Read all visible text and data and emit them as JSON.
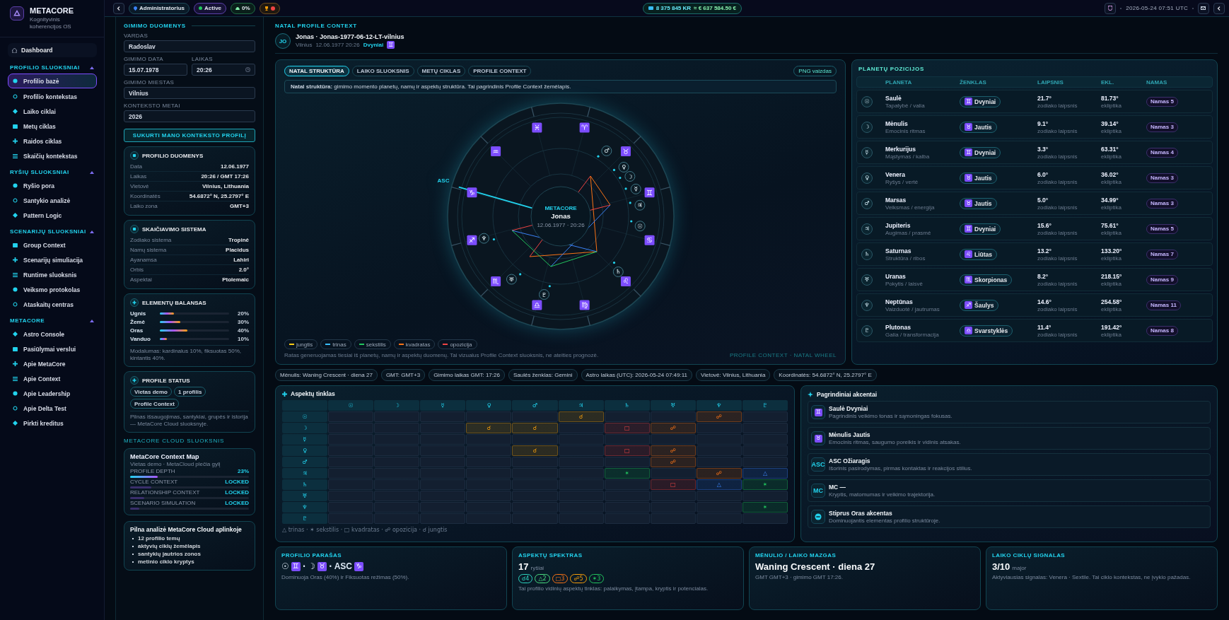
{
  "sidebar": {
    "brand": "METACORE",
    "tagline": "Kognityvinis koherencijos OS",
    "dashboard": "Dashboard",
    "sections": [
      {
        "title": "PROFILIO SLUOKSNIAI",
        "expanded": true,
        "items": [
          {
            "label": "Profilio bazė",
            "selected": true
          },
          {
            "label": "Profilio kontekstas",
            "selected": false
          },
          {
            "label": "Laiko ciklai",
            "selected": false
          },
          {
            "label": "Metų ciklas",
            "selected": false
          },
          {
            "label": "Raidos ciklas",
            "selected": false
          },
          {
            "label": "Skaičių kontekstas",
            "selected": false
          }
        ]
      },
      {
        "title": "RYŠIŲ SLUOKSNIAI",
        "expanded": true,
        "items": [
          {
            "label": "Ryšio pora",
            "selected": false
          },
          {
            "label": "Santykio analizė",
            "selected": false
          },
          {
            "label": "Pattern Logic",
            "selected": false
          }
        ]
      },
      {
        "title": "SCENARIJŲ SLUOKSNIAI",
        "expanded": true,
        "items": [
          {
            "label": "Group Context",
            "selected": false
          },
          {
            "label": "Scenarijų simuliacija",
            "selected": false
          },
          {
            "label": "Runtime sluoksnis",
            "selected": false
          },
          {
            "label": "Veiksmo protokolas",
            "selected": false
          },
          {
            "label": "Ataskaitų centras",
            "selected": false
          }
        ]
      },
      {
        "title": "METACORE",
        "expanded": true,
        "items": [
          {
            "label": "Astro Console",
            "selected": false
          },
          {
            "label": "Pasiūlymai verslui",
            "selected": false
          },
          {
            "label": "Apie MetaCore",
            "selected": false
          },
          {
            "label": "Apie Context",
            "selected": false
          },
          {
            "label": "Apie Leadership",
            "selected": false
          },
          {
            "label": "Apie Delta Test",
            "selected": false
          },
          {
            "label": "Pirkti kreditus",
            "selected": false
          }
        ]
      }
    ]
  },
  "topbar": {
    "role": "Administratorius",
    "status": "Active",
    "cloud": "0%",
    "balance_kr": "8 375 845 KR",
    "balance_eur": "≈ € 637 584.50 €",
    "datetime": "2026-05-24 07:51 UTC"
  },
  "birth_form": {
    "title": "GIMIMO DUOMENYS",
    "rows": [
      [
        {
          "kind": "text",
          "label": "VARDAS",
          "value": "Radoslav"
        }
      ],
      [
        {
          "kind": "text",
          "label": "GIMIMO DATA",
          "value": "15.07.1978"
        },
        {
          "kind": "time",
          "label": "LAIKAS",
          "value": "20:26"
        }
      ],
      [
        {
          "kind": "text",
          "label": "GIMIMO MIESTAS",
          "value": "Vilnius"
        }
      ],
      [
        {
          "kind": "text",
          "label": "KONTEKSTO METAI",
          "value": "2026"
        }
      ]
    ],
    "submit": "SUKURTI MANO KONTEKSTO PROFILĮ"
  },
  "profile_data": {
    "title": "PROFILIO DUOMENYS",
    "rows": [
      {
        "label": "Data",
        "value": "12.06.1977"
      },
      {
        "label": "Laikas",
        "value": "20:26 / GMT 17:26"
      },
      {
        "label": "Vietovė",
        "value": "Vilnius, Lithuania"
      },
      {
        "label": "Koordinatės",
        "value": "54.6872° N, 25.2797° E"
      },
      {
        "label": "Laiko zona",
        "value": "GMT+3"
      }
    ]
  },
  "calc_system": {
    "title": "SKAIČIAVIMO SISTEMA",
    "rows": [
      {
        "label": "Zodiako sistema",
        "value": "Tropinė"
      },
      {
        "label": "Namų sistema",
        "value": "Placidus"
      },
      {
        "label": "Ayanamsa",
        "value": "Lahiri"
      },
      {
        "label": "Orbis",
        "value": "2.0°"
      },
      {
        "label": "Aspektai",
        "value": "Ptolemaic"
      }
    ]
  },
  "elements": {
    "title": "ELEMENTŲ BALANSAS",
    "items": [
      {
        "name": "Ugnis",
        "level": 0.2,
        "reading": "20%"
      },
      {
        "name": "Žemė",
        "level": 0.3,
        "reading": "30%"
      },
      {
        "name": "Oras",
        "level": 0.4,
        "reading": "40%"
      },
      {
        "name": "Vanduo",
        "level": 0.1,
        "reading": "10%"
      }
    ],
    "note": "Modalumas: kardinalus 10%, fiksuotas 50%, kintantis 40%."
  },
  "profile_status": {
    "title": "PROFILE STATUS",
    "chips": [
      "Vietas demo",
      "1 profilis",
      "Profile Context"
    ],
    "note": "Pilnas išsaugojimas, santykiai, grupės ir istorija — MetaCore Cloud sluoksnyje."
  },
  "cloud_label": "METACORE CLOUD SLUOKSNIS",
  "context_map": {
    "title": "MetaCore Context Map",
    "subtitle": "Vietas demo · MetaCloud plečia gylį",
    "items": [
      {
        "label": "PROFILE DEPTH",
        "value": "23%",
        "locked": false,
        "level": 0.23
      },
      {
        "label": "CYCLE CONTEXT",
        "value": "LOCKED",
        "locked": true,
        "level": 0.18
      },
      {
        "label": "RELATIONSHIP CONTEXT",
        "value": "LOCKED",
        "locked": true,
        "level": 0.12
      },
      {
        "label": "SCENARIO SIMULATION",
        "value": "LOCKED",
        "locked": true,
        "level": 0.08
      }
    ]
  },
  "full_analysis": {
    "title": "Pilna analizė MetaCore Cloud aplinkoje",
    "items": [
      "12 profilio temų",
      "aktyvių ciklų žemėlapis",
      "santykių jautrios zonos",
      "metinio ciklo kryptys"
    ]
  },
  "header": {
    "section": "NATAL PROFILE CONTEXT",
    "initials": "JO",
    "title": "Jonas · Jonas-1977-06-12-LT-vilnius",
    "city": "Vilnius",
    "datetime": "12.06.1977 20:26",
    "sign": "Dvyniai",
    "sign_glyph": "♊"
  },
  "wheel_card": {
    "tabs": [
      {
        "label": "NATAL STRUKTŪRA",
        "selected": true
      },
      {
        "label": "LAIKO SLUOKSNIS",
        "selected": false
      },
      {
        "label": "METŲ CIKLAS",
        "selected": false
      },
      {
        "label": "PROFILE CONTEXT",
        "selected": false
      }
    ],
    "png_button": "PNG vaizdas",
    "note": "**Natal struktūra:** gimimo momento planetų, namų ir aspektų struktūra. Tai pagrindinis Profile Context žemėlapis.",
    "wheel": {
      "signs": [
        "♈",
        "♉",
        "♊",
        "♋",
        "♌",
        "♍",
        "♎",
        "♏",
        "♐",
        "♑",
        "♒",
        "♓"
      ],
      "planets": [
        "♂",
        "♀",
        "☽",
        "☿",
        "♃",
        "☉",
        "♄",
        "♇",
        "♅",
        "♆"
      ],
      "asc": "ASC",
      "center_brand": "METACORE",
      "center_name": "Jonas",
      "center_date": "12.06.1977 · 20:26"
    },
    "legend": [
      {
        "label": "jungtis",
        "color": "#facc15"
      },
      {
        "label": "trinas",
        "color": "#38bdf8"
      },
      {
        "label": "sekstilis",
        "color": "#22c55e"
      },
      {
        "label": "kvadratas",
        "color": "#f97316"
      },
      {
        "label": "opozicija",
        "color": "#ef4444"
      }
    ],
    "footer": "Ratas generuojamas tiesiai iš planetų, namų ir aspektų duomenų. Tai vizualus Profile Context sluoksnis, ne ateities prognozė.",
    "footer_tag": "PROFILE CONTEXT · NATAL WHEEL"
  },
  "planet_table": {
    "title": "PLANETŲ POZICIJOS",
    "columns": [
      "PLANETA",
      "ŽENKLAS",
      "LAIPSNIS",
      "EKL.",
      "NAMAS"
    ],
    "rows": [
      {
        "glyph": "☉",
        "name": "Saulė",
        "meaning": "Tapatybė / valia",
        "sign_glyph": "♊",
        "sign": "Dvyniai",
        "degree": "21.7°",
        "degree_note": "zodiako laipsnis",
        "ecliptic": "81.73°",
        "ecliptic_note": "ekliptika",
        "house": "Namas 5"
      },
      {
        "glyph": "☽",
        "name": "Mėnulis",
        "meaning": "Emocinis ritmas",
        "sign_glyph": "♉",
        "sign": "Jautis",
        "degree": "9.1°",
        "degree_note": "zodiako laipsnis",
        "ecliptic": "39.14°",
        "ecliptic_note": "ekliptika",
        "house": "Namas 3"
      },
      {
        "glyph": "☿",
        "name": "Merkurijus",
        "meaning": "Mąstymas / kalba",
        "sign_glyph": "♊",
        "sign": "Dvyniai",
        "degree": "3.3°",
        "degree_note": "zodiako laipsnis",
        "ecliptic": "63.31°",
        "ecliptic_note": "ekliptika",
        "house": "Namas 4"
      },
      {
        "glyph": "♀",
        "name": "Venera",
        "meaning": "Ryšys / vertė",
        "sign_glyph": "♉",
        "sign": "Jautis",
        "degree": "6.0°",
        "degree_note": "zodiako laipsnis",
        "ecliptic": "36.02°",
        "ecliptic_note": "ekliptika",
        "house": "Namas 3"
      },
      {
        "glyph": "♂",
        "name": "Marsas",
        "meaning": "Veiksmas / energija",
        "sign_glyph": "♉",
        "sign": "Jautis",
        "degree": "5.0°",
        "degree_note": "zodiako laipsnis",
        "ecliptic": "34.99°",
        "ecliptic_note": "ekliptika",
        "house": "Namas 3"
      },
      {
        "glyph": "♃",
        "name": "Jupiteris",
        "meaning": "Augimas / prasmė",
        "sign_glyph": "♊",
        "sign": "Dvyniai",
        "degree": "15.6°",
        "degree_note": "zodiako laipsnis",
        "ecliptic": "75.61°",
        "ecliptic_note": "ekliptika",
        "house": "Namas 5"
      },
      {
        "glyph": "♄",
        "name": "Saturnas",
        "meaning": "Struktūra / ribos",
        "sign_glyph": "♌",
        "sign": "Liūtas",
        "degree": "13.2°",
        "degree_note": "zodiako laipsnis",
        "ecliptic": "133.20°",
        "ecliptic_note": "ekliptika",
        "house": "Namas 7"
      },
      {
        "glyph": "♅",
        "name": "Uranas",
        "meaning": "Pokytis / laisvė",
        "sign_glyph": "♏",
        "sign": "Skorpionas",
        "degree": "8.2°",
        "degree_note": "zodiako laipsnis",
        "ecliptic": "218.15°",
        "ecliptic_note": "ekliptika",
        "house": "Namas 9"
      },
      {
        "glyph": "♆",
        "name": "Neptūnas",
        "meaning": "Vaizduotė / jautrumas",
        "sign_glyph": "♐",
        "sign": "Šaulys",
        "degree": "14.6°",
        "degree_note": "zodiako laipsnis",
        "ecliptic": "254.58°",
        "ecliptic_note": "ekliptika",
        "house": "Namas 11"
      },
      {
        "glyph": "♇",
        "name": "Plutonas",
        "meaning": "Galia / transformacija",
        "sign_glyph": "♎",
        "sign": "Svarstyklės",
        "degree": "11.4°",
        "degree_note": "zodiako laipsnis",
        "ecliptic": "191.42°",
        "ecliptic_note": "ekliptika",
        "house": "Namas 8"
      }
    ]
  },
  "info_chips": [
    "Mėnulis: Waning Crescent · diena 27",
    "GMT: GMT+3",
    "Gimimo laikas GMT: 17:26",
    "Saulės ženklas: Gemini",
    "Astro laikas (UTC): 2026-05-24 07:49:11",
    "Vietovė: Vilnius, Lithuania",
    "Koordinatės: 54.6872° N, 25.2797° E"
  ],
  "aspect_grid": {
    "title": "Aspektų tinklas",
    "columns": [
      "☉",
      "☽",
      "☿",
      "♀",
      "♂",
      "♃",
      "♄",
      "♅",
      "♆",
      "♇"
    ],
    "rows": [
      {
        "glyph": "☉",
        "cells": [
          {
            "kind": "empty"
          },
          {
            "kind": "empty"
          },
          {
            "kind": "empty"
          },
          {
            "kind": "empty"
          },
          {
            "kind": "empty"
          },
          {
            "kind": "conjunction",
            "symbol": "☌"
          },
          {
            "kind": "empty"
          },
          {
            "kind": "empty"
          },
          {
            "kind": "opposition",
            "symbol": "☍"
          },
          {
            "kind": "empty"
          }
        ]
      },
      {
        "glyph": "☽",
        "cells": [
          {
            "kind": "empty"
          },
          {
            "kind": "empty"
          },
          {
            "kind": "empty"
          },
          {
            "kind": "conjunction",
            "symbol": "☌"
          },
          {
            "kind": "conjunction",
            "symbol": "☌"
          },
          {
            "kind": "empty"
          },
          {
            "kind": "square",
            "symbol": "□"
          },
          {
            "kind": "opposition",
            "symbol": "☍"
          },
          {
            "kind": "empty"
          },
          {
            "kind": "empty"
          }
        ]
      },
      {
        "glyph": "☿",
        "cells": [
          {
            "kind": "empty"
          },
          {
            "kind": "empty"
          },
          {
            "kind": "empty"
          },
          {
            "kind": "empty"
          },
          {
            "kind": "empty"
          },
          {
            "kind": "empty"
          },
          {
            "kind": "empty"
          },
          {
            "kind": "empty"
          },
          {
            "kind": "empty"
          },
          {
            "kind": "empty"
          }
        ]
      },
      {
        "glyph": "♀",
        "cells": [
          {
            "kind": "empty"
          },
          {
            "kind": "empty"
          },
          {
            "kind": "empty"
          },
          {
            "kind": "empty"
          },
          {
            "kind": "conjunction",
            "symbol": "☌"
          },
          {
            "kind": "empty"
          },
          {
            "kind": "square",
            "symbol": "□"
          },
          {
            "kind": "opposition",
            "symbol": "☍"
          },
          {
            "kind": "empty"
          },
          {
            "kind": "empty"
          }
        ]
      },
      {
        "glyph": "♂",
        "cells": [
          {
            "kind": "empty"
          },
          {
            "kind": "empty"
          },
          {
            "kind": "empty"
          },
          {
            "kind": "empty"
          },
          {
            "kind": "empty"
          },
          {
            "kind": "empty"
          },
          {
            "kind": "empty"
          },
          {
            "kind": "opposition",
            "symbol": "☍"
          },
          {
            "kind": "empty"
          },
          {
            "kind": "empty"
          }
        ]
      },
      {
        "glyph": "♃",
        "cells": [
          {
            "kind": "empty"
          },
          {
            "kind": "empty"
          },
          {
            "kind": "empty"
          },
          {
            "kind": "empty"
          },
          {
            "kind": "empty"
          },
          {
            "kind": "empty"
          },
          {
            "kind": "sextile",
            "symbol": "✶"
          },
          {
            "kind": "empty"
          },
          {
            "kind": "opposition",
            "symbol": "☍"
          },
          {
            "kind": "trine",
            "symbol": "△"
          }
        ]
      },
      {
        "glyph": "♄",
        "cells": [
          {
            "kind": "empty"
          },
          {
            "kind": "empty"
          },
          {
            "kind": "empty"
          },
          {
            "kind": "empty"
          },
          {
            "kind": "empty"
          },
          {
            "kind": "empty"
          },
          {
            "kind": "empty"
          },
          {
            "kind": "square",
            "symbol": "□"
          },
          {
            "kind": "trine",
            "symbol": "△"
          },
          {
            "kind": "sextile",
            "symbol": "✶"
          }
        ]
      },
      {
        "glyph": "♅",
        "cells": [
          {
            "kind": "empty"
          },
          {
            "kind": "empty"
          },
          {
            "kind": "empty"
          },
          {
            "kind": "empty"
          },
          {
            "kind": "empty"
          },
          {
            "kind": "empty"
          },
          {
            "kind": "empty"
          },
          {
            "kind": "empty"
          },
          {
            "kind": "empty"
          },
          {
            "kind": "empty"
          }
        ]
      },
      {
        "glyph": "♆",
        "cells": [
          {
            "kind": "empty"
          },
          {
            "kind": "empty"
          },
          {
            "kind": "empty"
          },
          {
            "kind": "empty"
          },
          {
            "kind": "empty"
          },
          {
            "kind": "empty"
          },
          {
            "kind": "empty"
          },
          {
            "kind": "empty"
          },
          {
            "kind": "empty"
          },
          {
            "kind": "sextile",
            "symbol": "✶"
          }
        ]
      },
      {
        "glyph": "♇",
        "cells": [
          {
            "kind": "empty"
          },
          {
            "kind": "empty"
          },
          {
            "kind": "empty"
          },
          {
            "kind": "empty"
          },
          {
            "kind": "empty"
          },
          {
            "kind": "empty"
          },
          {
            "kind": "empty"
          },
          {
            "kind": "empty"
          },
          {
            "kind": "empty"
          },
          {
            "kind": "empty"
          }
        ]
      }
    ],
    "legend": "△ trinas · ✶ sekstilis · □ kvadratas · ☍ opozicija · ☌ jungtis"
  },
  "accents": {
    "title": "Pagrindiniai akcentai",
    "items": [
      {
        "kind": "sign",
        "icon": "♊",
        "title": "Saulė Dvyniai",
        "text": "Pagrindinis veikimo tonas ir sąmoningas fokusas."
      },
      {
        "kind": "sign",
        "icon": "♉",
        "title": "Mėnulis Jautis",
        "text": "Emocinis ritmas, saugumo poreikis ir vidinis atsakas."
      },
      {
        "kind": "label",
        "icon": "ASC",
        "title": "ASC Ožiaragis",
        "text": "Išorinis pasirodymas, pirmas kontaktas ir reakcijos stilius."
      },
      {
        "kind": "label",
        "icon": "MC",
        "title": "MC —",
        "text": "Kryptis, matomumas ir veikimo trajektorija."
      },
      {
        "kind": "element",
        "title": "Stiprus Oras akcentas",
        "text": "Dominuojantis elementas profilio struktūroje."
      }
    ]
  },
  "summary_cards": [
    {
      "kind": "signature",
      "label": "PROFILIO PARAŠAS",
      "parts": [
        {
          "kind": "planet",
          "text": "☉"
        },
        {
          "kind": "sign",
          "text": "♊"
        },
        {
          "kind": "separator",
          "text": "·"
        },
        {
          "kind": "planet",
          "text": "☽"
        },
        {
          "kind": "sign",
          "text": "♉"
        },
        {
          "kind": "separator",
          "text": "·"
        },
        {
          "kind": "label",
          "text": "ASC"
        },
        {
          "kind": "sign",
          "text": "♑"
        }
      ],
      "text": "Dominuoja Oras (40%) ir Fiksuotas režimas (50%)."
    },
    {
      "kind": "spectrum",
      "label": "ASPEKTŲ SPEKTRAS",
      "value": "17",
      "unit": "ryšiai",
      "chips": [
        {
          "label": "☌4",
          "color": "#2dd4bf"
        },
        {
          "label": "△2",
          "color": "#4ade80"
        },
        {
          "label": "□3",
          "color": "#f97316"
        },
        {
          "label": "☍5",
          "color": "#f59e0b"
        },
        {
          "label": "✶3",
          "color": "#22c55e"
        }
      ],
      "text": "Tai profilio vidinių aspektų tinklas: palaikymas, įtampa, kryptis ir potencialas."
    },
    {
      "kind": "value",
      "label": "MĖNULIO / LAIKO MAZGAS",
      "value": "Waning Crescent · diena 27",
      "text": "GMT GMT+3 · gimimo GMT 17:26."
    },
    {
      "kind": "value",
      "label": "LAIKO CIKLŲ SIGNALAS",
      "value": "3/10",
      "unit": "major",
      "text": "Aktyviausias signalas: Venera · Sextile. Tai ciklo kontekstas, ne įvykio pažadas."
    }
  ]
}
